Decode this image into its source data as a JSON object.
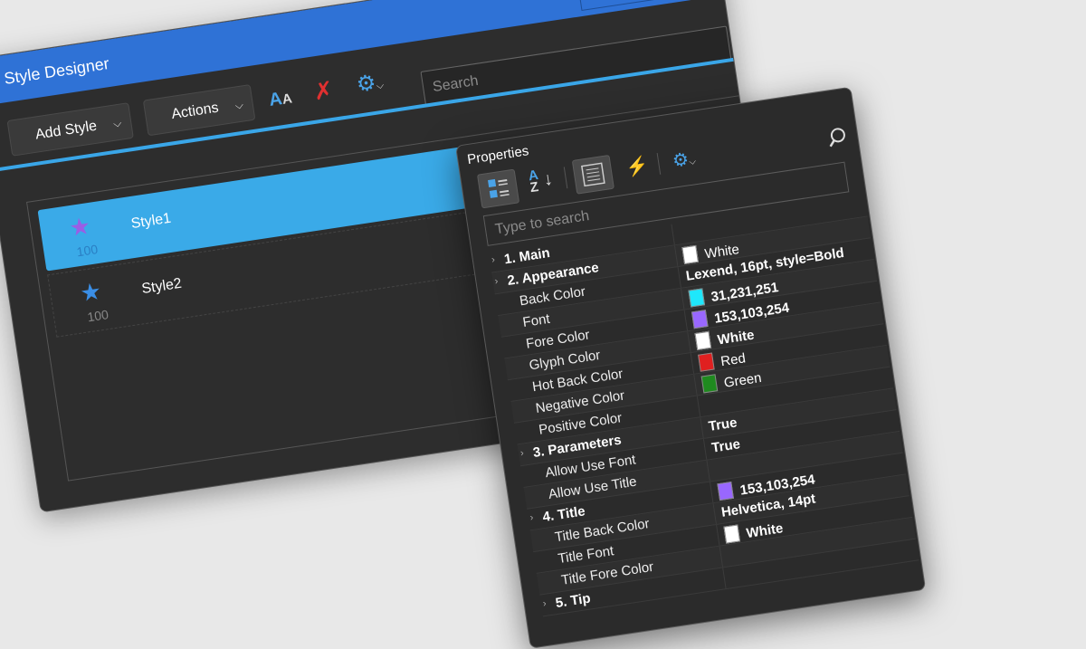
{
  "style_designer": {
    "title": "Style Designer",
    "add_style_label": "Add Style",
    "actions_label": "Actions",
    "search_placeholder": "Search",
    "styles": [
      {
        "label": "Style1",
        "number": "100",
        "star_color": "#9b5de5",
        "selected": true
      },
      {
        "label": "Style2",
        "number": "100",
        "star_color": "#3a8ee6",
        "selected": false
      }
    ]
  },
  "properties": {
    "title": "Properties",
    "search_placeholder": "Type to search",
    "rows": [
      {
        "type": "cat",
        "name": "1. Main",
        "value": "",
        "swatch": ""
      },
      {
        "type": "cat",
        "name": "2. Appearance",
        "value": "White",
        "swatch": "#ffffff",
        "bold": false
      },
      {
        "type": "prop",
        "name": "Back Color",
        "value": "Lexend, 16pt, style=Bold",
        "swatch": "",
        "bold": true
      },
      {
        "type": "prop",
        "name": "Font",
        "value": "31,231,251",
        "swatch": "#1fe7fb",
        "bold": true
      },
      {
        "type": "prop",
        "name": "Fore Color",
        "value": "153,103,254",
        "swatch": "#9967fe",
        "bold": true
      },
      {
        "type": "prop",
        "name": "Glyph Color",
        "value": "White",
        "swatch": "#ffffff",
        "bold": true
      },
      {
        "type": "prop",
        "name": "Hot Back Color",
        "value": "Red",
        "swatch": "#e02020",
        "bold": false
      },
      {
        "type": "prop",
        "name": "Negative Color",
        "value": "Green",
        "swatch": "#1f8a1f",
        "bold": false
      },
      {
        "type": "prop",
        "name": "Positive Color",
        "value": "",
        "swatch": ""
      },
      {
        "type": "cat",
        "name": "3. Parameters",
        "value": "True",
        "swatch": "",
        "bold": true
      },
      {
        "type": "prop",
        "name": "Allow Use Font",
        "value": "True",
        "swatch": "",
        "bold": true
      },
      {
        "type": "prop",
        "name": "Allow Use Title",
        "value": "",
        "swatch": ""
      },
      {
        "type": "cat",
        "name": "4. Title",
        "value": "153,103,254",
        "swatch": "#9967fe",
        "bold": true
      },
      {
        "type": "prop",
        "name": "Title Back Color",
        "value": "Helvetica, 14pt",
        "swatch": "",
        "bold": true
      },
      {
        "type": "prop",
        "name": "Title Font",
        "value": "White",
        "swatch": "#ffffff",
        "bold": true
      },
      {
        "type": "prop",
        "name": "Title Fore Color",
        "value": "",
        "swatch": ""
      },
      {
        "type": "cat",
        "name": "5. Tip",
        "value": "",
        "swatch": ""
      }
    ]
  },
  "colors": {
    "titlebar": "#2f72d6",
    "selected": "#3aaae8",
    "accent": "#4aa3e8",
    "lightning": "#f0a030",
    "delete": "#e03030"
  }
}
